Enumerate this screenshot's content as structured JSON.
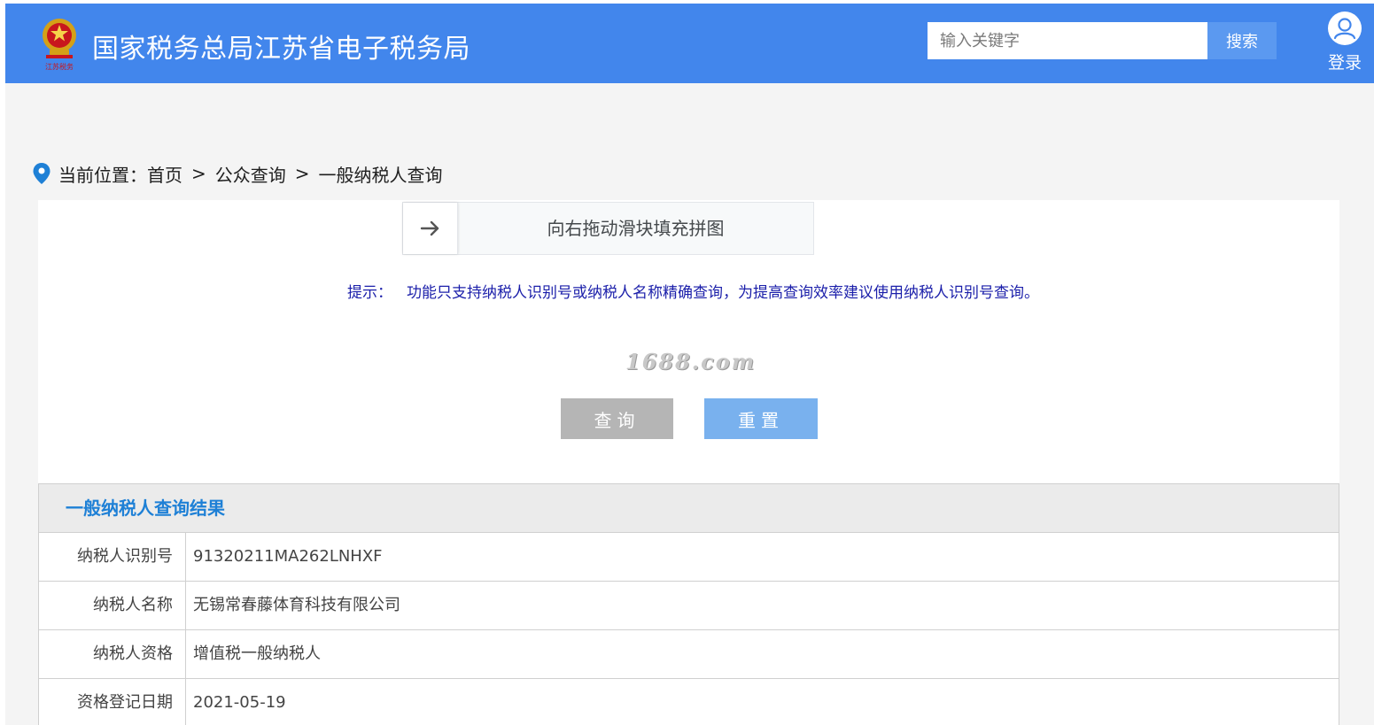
{
  "header": {
    "logo_text": "江苏税务",
    "title": "国家税务总局江苏省电子税务局",
    "search_placeholder": "输入关键字",
    "search_button": "搜索",
    "login_label": "登录"
  },
  "breadcrumb": {
    "label": "当前位置：",
    "items": [
      "首页",
      "公众查询",
      "一般纳税人查询"
    ],
    "separator": ">"
  },
  "slider": {
    "hint": "向右拖动滑块填充拼图"
  },
  "tip": {
    "label": "提示：",
    "text": "功能只支持纳税人识别号或纳税人名称精确查询，为提高查询效率建议使用纳税人识别号查询。"
  },
  "watermark": "1688.com",
  "buttons": {
    "query": "查询",
    "reset": "重置"
  },
  "result": {
    "title": "一般纳税人查询结果",
    "rows": [
      {
        "label": "纳税人识别号",
        "value": "91320211MA262LNHXF"
      },
      {
        "label": "纳税人名称",
        "value": "无锡常春藤体育科技有限公司"
      },
      {
        "label": "纳税人资格",
        "value": "增值税一般纳税人"
      },
      {
        "label": "资格登记日期",
        "value": "2021-05-19"
      }
    ]
  },
  "colors": {
    "header_bg": "#4286ec",
    "search_btn": "#5b99f0",
    "query_btn": "#b5b5b5",
    "reset_btn": "#79b1ee",
    "tip_text": "#1b1faa",
    "result_title": "#1e80d6"
  },
  "icons": [
    "tax-emblem-icon",
    "user-icon",
    "location-pin-icon",
    "arrow-right-icon"
  ]
}
